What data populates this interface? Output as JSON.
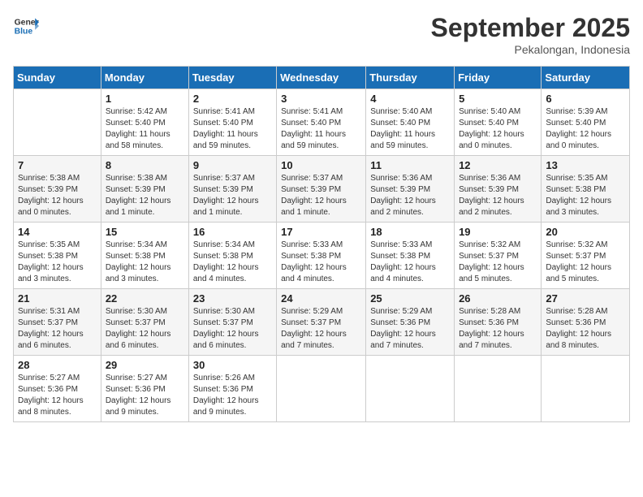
{
  "header": {
    "logo_line1": "General",
    "logo_line2": "Blue",
    "month": "September 2025",
    "location": "Pekalongan, Indonesia"
  },
  "days_of_week": [
    "Sunday",
    "Monday",
    "Tuesday",
    "Wednesday",
    "Thursday",
    "Friday",
    "Saturday"
  ],
  "weeks": [
    [
      {
        "num": "",
        "info": ""
      },
      {
        "num": "1",
        "info": "Sunrise: 5:42 AM\nSunset: 5:40 PM\nDaylight: 11 hours\nand 58 minutes."
      },
      {
        "num": "2",
        "info": "Sunrise: 5:41 AM\nSunset: 5:40 PM\nDaylight: 11 hours\nand 59 minutes."
      },
      {
        "num": "3",
        "info": "Sunrise: 5:41 AM\nSunset: 5:40 PM\nDaylight: 11 hours\nand 59 minutes."
      },
      {
        "num": "4",
        "info": "Sunrise: 5:40 AM\nSunset: 5:40 PM\nDaylight: 11 hours\nand 59 minutes."
      },
      {
        "num": "5",
        "info": "Sunrise: 5:40 AM\nSunset: 5:40 PM\nDaylight: 12 hours\nand 0 minutes."
      },
      {
        "num": "6",
        "info": "Sunrise: 5:39 AM\nSunset: 5:40 PM\nDaylight: 12 hours\nand 0 minutes."
      }
    ],
    [
      {
        "num": "7",
        "info": "Sunrise: 5:38 AM\nSunset: 5:39 PM\nDaylight: 12 hours\nand 0 minutes."
      },
      {
        "num": "8",
        "info": "Sunrise: 5:38 AM\nSunset: 5:39 PM\nDaylight: 12 hours\nand 1 minute."
      },
      {
        "num": "9",
        "info": "Sunrise: 5:37 AM\nSunset: 5:39 PM\nDaylight: 12 hours\nand 1 minute."
      },
      {
        "num": "10",
        "info": "Sunrise: 5:37 AM\nSunset: 5:39 PM\nDaylight: 12 hours\nand 1 minute."
      },
      {
        "num": "11",
        "info": "Sunrise: 5:36 AM\nSunset: 5:39 PM\nDaylight: 12 hours\nand 2 minutes."
      },
      {
        "num": "12",
        "info": "Sunrise: 5:36 AM\nSunset: 5:39 PM\nDaylight: 12 hours\nand 2 minutes."
      },
      {
        "num": "13",
        "info": "Sunrise: 5:35 AM\nSunset: 5:38 PM\nDaylight: 12 hours\nand 3 minutes."
      }
    ],
    [
      {
        "num": "14",
        "info": "Sunrise: 5:35 AM\nSunset: 5:38 PM\nDaylight: 12 hours\nand 3 minutes."
      },
      {
        "num": "15",
        "info": "Sunrise: 5:34 AM\nSunset: 5:38 PM\nDaylight: 12 hours\nand 3 minutes."
      },
      {
        "num": "16",
        "info": "Sunrise: 5:34 AM\nSunset: 5:38 PM\nDaylight: 12 hours\nand 4 minutes."
      },
      {
        "num": "17",
        "info": "Sunrise: 5:33 AM\nSunset: 5:38 PM\nDaylight: 12 hours\nand 4 minutes."
      },
      {
        "num": "18",
        "info": "Sunrise: 5:33 AM\nSunset: 5:38 PM\nDaylight: 12 hours\nand 4 minutes."
      },
      {
        "num": "19",
        "info": "Sunrise: 5:32 AM\nSunset: 5:37 PM\nDaylight: 12 hours\nand 5 minutes."
      },
      {
        "num": "20",
        "info": "Sunrise: 5:32 AM\nSunset: 5:37 PM\nDaylight: 12 hours\nand 5 minutes."
      }
    ],
    [
      {
        "num": "21",
        "info": "Sunrise: 5:31 AM\nSunset: 5:37 PM\nDaylight: 12 hours\nand 6 minutes."
      },
      {
        "num": "22",
        "info": "Sunrise: 5:30 AM\nSunset: 5:37 PM\nDaylight: 12 hours\nand 6 minutes."
      },
      {
        "num": "23",
        "info": "Sunrise: 5:30 AM\nSunset: 5:37 PM\nDaylight: 12 hours\nand 6 minutes."
      },
      {
        "num": "24",
        "info": "Sunrise: 5:29 AM\nSunset: 5:37 PM\nDaylight: 12 hours\nand 7 minutes."
      },
      {
        "num": "25",
        "info": "Sunrise: 5:29 AM\nSunset: 5:36 PM\nDaylight: 12 hours\nand 7 minutes."
      },
      {
        "num": "26",
        "info": "Sunrise: 5:28 AM\nSunset: 5:36 PM\nDaylight: 12 hours\nand 7 minutes."
      },
      {
        "num": "27",
        "info": "Sunrise: 5:28 AM\nSunset: 5:36 PM\nDaylight: 12 hours\nand 8 minutes."
      }
    ],
    [
      {
        "num": "28",
        "info": "Sunrise: 5:27 AM\nSunset: 5:36 PM\nDaylight: 12 hours\nand 8 minutes."
      },
      {
        "num": "29",
        "info": "Sunrise: 5:27 AM\nSunset: 5:36 PM\nDaylight: 12 hours\nand 9 minutes."
      },
      {
        "num": "30",
        "info": "Sunrise: 5:26 AM\nSunset: 5:36 PM\nDaylight: 12 hours\nand 9 minutes."
      },
      {
        "num": "",
        "info": ""
      },
      {
        "num": "",
        "info": ""
      },
      {
        "num": "",
        "info": ""
      },
      {
        "num": "",
        "info": ""
      }
    ]
  ]
}
